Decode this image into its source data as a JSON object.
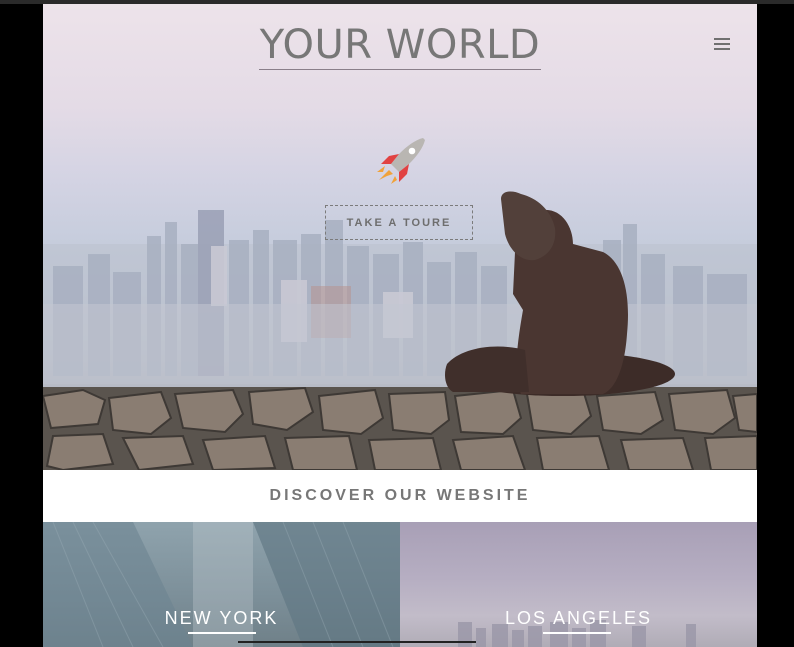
{
  "header": {
    "title": "YOUR WORLD",
    "menu_icon": "hamburger-menu-icon"
  },
  "hero": {
    "cta_label": "TAKE A TOURE",
    "rocket_icon": "rocket-icon"
  },
  "section": {
    "title": "DISCOVER OUR WEBSITE"
  },
  "cities": [
    {
      "name": "NEW YORK"
    },
    {
      "name": "LOS ANGELES"
    }
  ]
}
